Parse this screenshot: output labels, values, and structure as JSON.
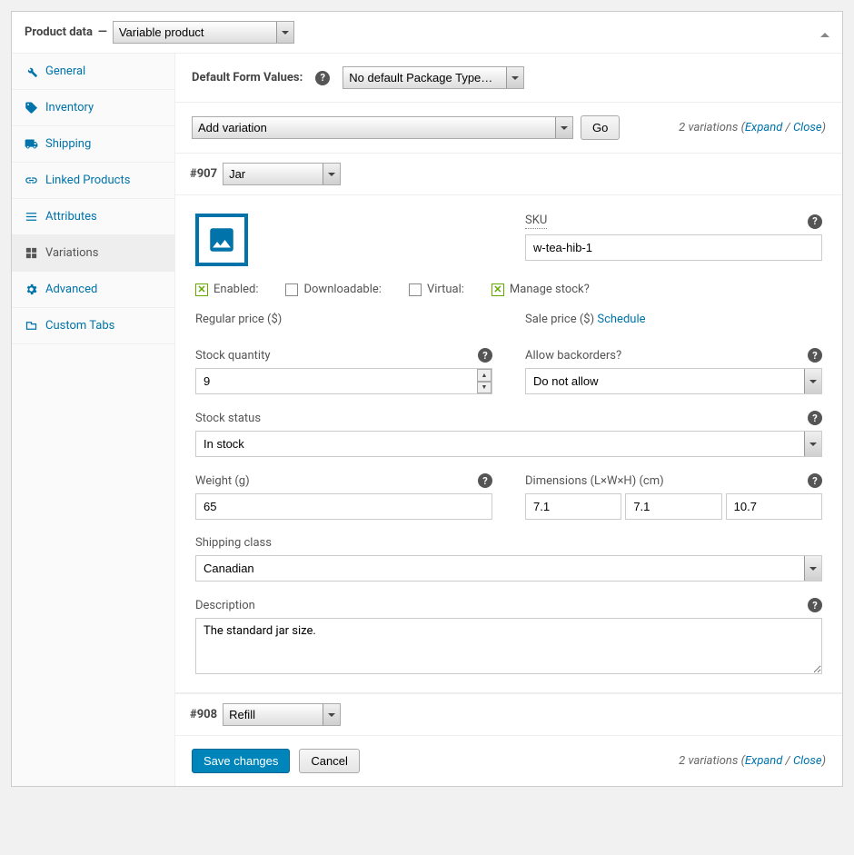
{
  "header": {
    "title": "Product data",
    "sep": "—",
    "type": "Variable product"
  },
  "sidebar": {
    "items": [
      {
        "label": "General"
      },
      {
        "label": "Inventory"
      },
      {
        "label": "Shipping"
      },
      {
        "label": "Linked Products"
      },
      {
        "label": "Attributes"
      },
      {
        "label": "Variations"
      },
      {
        "label": "Advanced"
      },
      {
        "label": "Custom Tabs"
      }
    ]
  },
  "defaults": {
    "label": "Default Form Values:",
    "value": "No default Package Type…"
  },
  "toolbar": {
    "add_variation": "Add variation",
    "go": "Go",
    "count_text": "2 variations",
    "expand": "Expand",
    "close": "Close"
  },
  "variation1": {
    "id": "#907",
    "attr": "Jar",
    "sku_label": "SKU",
    "sku_value": "w-tea-hib-1",
    "checks": {
      "enabled": "Enabled:",
      "downloadable": "Downloadable:",
      "virtual": "Virtual:",
      "manage_stock": "Manage stock?"
    },
    "regular_price_label": "Regular price ($)",
    "sale_price_label": "Sale price ($)",
    "schedule": "Schedule",
    "stock_qty_label": "Stock quantity",
    "stock_qty_value": "9",
    "backorders_label": "Allow backorders?",
    "backorders_value": "Do not allow",
    "stock_status_label": "Stock status",
    "stock_status_value": "In stock",
    "weight_label": "Weight (g)",
    "weight_value": "65",
    "dimensions_label": "Dimensions (L×W×H) (cm)",
    "dim_l": "7.1",
    "dim_w": "7.1",
    "dim_h": "10.7",
    "shipping_class_label": "Shipping class",
    "shipping_class_value": "Canadian",
    "description_label": "Description",
    "description_value": "The standard jar size."
  },
  "variation2": {
    "id": "#908",
    "attr": "Refill"
  },
  "footer": {
    "save": "Save changes",
    "cancel": "Cancel",
    "count_text": "2 variations",
    "expand": "Expand",
    "close": "Close"
  }
}
